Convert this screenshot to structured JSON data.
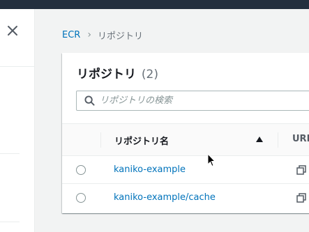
{
  "breadcrumb": {
    "root": "ECR",
    "separator": "›",
    "current": "リポジトリ"
  },
  "panel": {
    "title": "リポジトリ",
    "count": "(2)"
  },
  "search": {
    "placeholder": "リポジトリの検索",
    "value": ""
  },
  "table": {
    "columns": {
      "name": "リポジトリ名",
      "uri": "URI"
    },
    "sort": "ascending",
    "rows": [
      {
        "name": "kaniko-example"
      },
      {
        "name": "kaniko-example/cache"
      }
    ]
  },
  "icons": {
    "close": "close-icon",
    "search": "search-icon",
    "sort": "sort-ascending-icon",
    "copy": "copy-icon",
    "cursor": "mouse-cursor-icon"
  },
  "colors": {
    "topbar": "#232f3e",
    "link": "#0073bb",
    "background": "#f2f3f3"
  }
}
